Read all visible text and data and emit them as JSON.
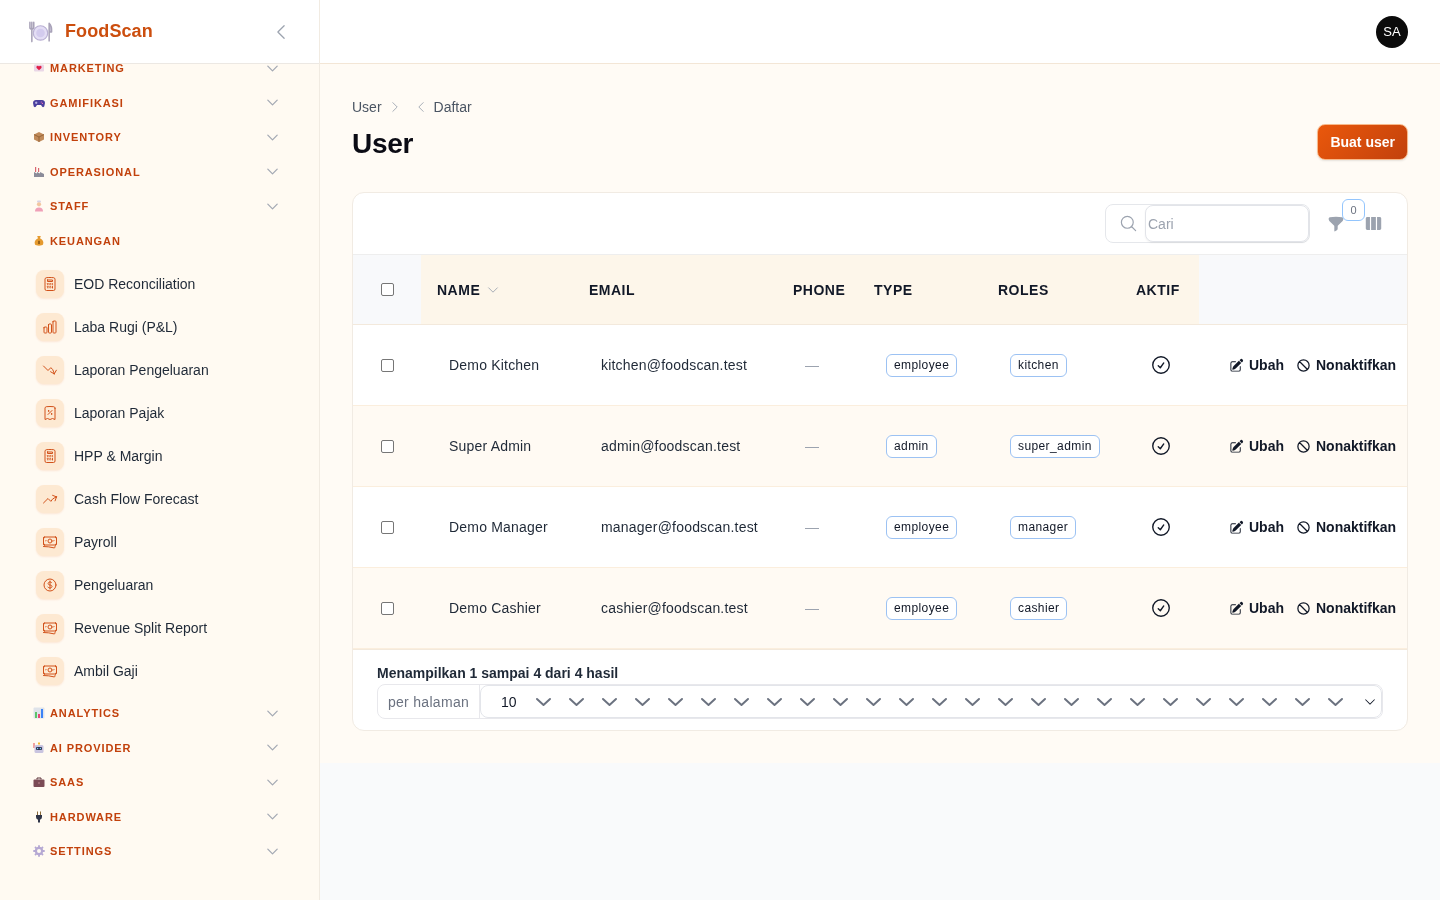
{
  "app": {
    "name": "FoodScan"
  },
  "sidebar": {
    "groups": [
      {
        "label": "MARKETING",
        "expanded": false
      },
      {
        "label": "GAMIFIKASI",
        "expanded": false
      },
      {
        "label": "INVENTORY",
        "expanded": false
      },
      {
        "label": "OPERASIONAL",
        "expanded": false
      },
      {
        "label": "STAFF",
        "expanded": false
      },
      {
        "label": "KEUANGAN",
        "expanded": true,
        "items": [
          {
            "label": "EOD Reconciliation",
            "selected": false
          },
          {
            "label": "Laba Rugi (P&L)",
            "selected": false
          },
          {
            "label": "Laporan Pengeluaran",
            "selected": false
          },
          {
            "label": "Laporan Pajak",
            "selected": false
          },
          {
            "label": "HPP & Margin",
            "selected": false
          },
          {
            "label": "Cash Flow Forecast",
            "selected": false
          },
          {
            "label": "Payroll",
            "selected": false
          },
          {
            "label": "Pengeluaran",
            "selected": false
          },
          {
            "label": "Revenue Split Report",
            "selected": false
          },
          {
            "label": "Ambil Gaji",
            "selected": false
          }
        ]
      },
      {
        "label": "ANALYTICS",
        "expanded": false
      },
      {
        "label": "AI PROVIDER",
        "expanded": false
      },
      {
        "label": "SAAS",
        "expanded": false
      },
      {
        "label": "HARDWARE",
        "expanded": false
      },
      {
        "label": "SETTINGS",
        "expanded": false
      }
    ]
  },
  "topbar": {
    "avatar": "SA"
  },
  "breadcrumbs": [
    "User",
    "Daftar"
  ],
  "page_title": "User",
  "primary_action": "Buat user",
  "table": {
    "search": {
      "placeholder": "Cari"
    },
    "filter_count": "0",
    "select_all": {
      "checked": false
    },
    "columns": [
      {
        "label": "NAME",
        "sortable": true
      },
      {
        "label": "EMAIL",
        "sortable": false
      },
      {
        "label": "PHONE",
        "sortable": false
      },
      {
        "label": "TYPE",
        "sortable": false
      },
      {
        "label": "ROLES",
        "sortable": false
      },
      {
        "label": "AKTIF",
        "sortable": false
      }
    ],
    "rows": [
      {
        "checked": false,
        "name": "Demo Kitchen",
        "email": "kitchen@foodscan.test",
        "phone": "—",
        "type": "employee",
        "roles": "kitchen",
        "active": true,
        "actions": [
          {
            "kind": "edit",
            "label": "Ubah"
          },
          {
            "kind": "deactivate",
            "label": "Nonaktifkan"
          }
        ]
      },
      {
        "checked": false,
        "name": "Super Admin",
        "email": "admin@foodscan.test",
        "phone": "—",
        "type": "admin",
        "roles": "super_admin",
        "active": true,
        "actions": [
          {
            "kind": "edit",
            "label": "Ubah"
          },
          {
            "kind": "deactivate",
            "label": "Nonaktifkan"
          }
        ]
      },
      {
        "checked": false,
        "name": "Demo Manager",
        "email": "manager@foodscan.test",
        "phone": "—",
        "type": "employee",
        "roles": "manager",
        "active": true,
        "actions": [
          {
            "kind": "edit",
            "label": "Ubah"
          },
          {
            "kind": "deactivate",
            "label": "Nonaktifkan"
          }
        ]
      },
      {
        "checked": false,
        "name": "Demo Cashier",
        "email": "cashier@foodscan.test",
        "phone": "—",
        "type": "employee",
        "roles": "cashier",
        "active": true,
        "actions": [
          {
            "kind": "edit",
            "label": "Ubah"
          },
          {
            "kind": "deactivate",
            "label": "Nonaktifkan"
          }
        ]
      }
    ],
    "summary": "Menampilkan 1 sampai 4 dari 4 hasil",
    "per_page": {
      "label": "per halaman",
      "value": "10"
    }
  }
}
